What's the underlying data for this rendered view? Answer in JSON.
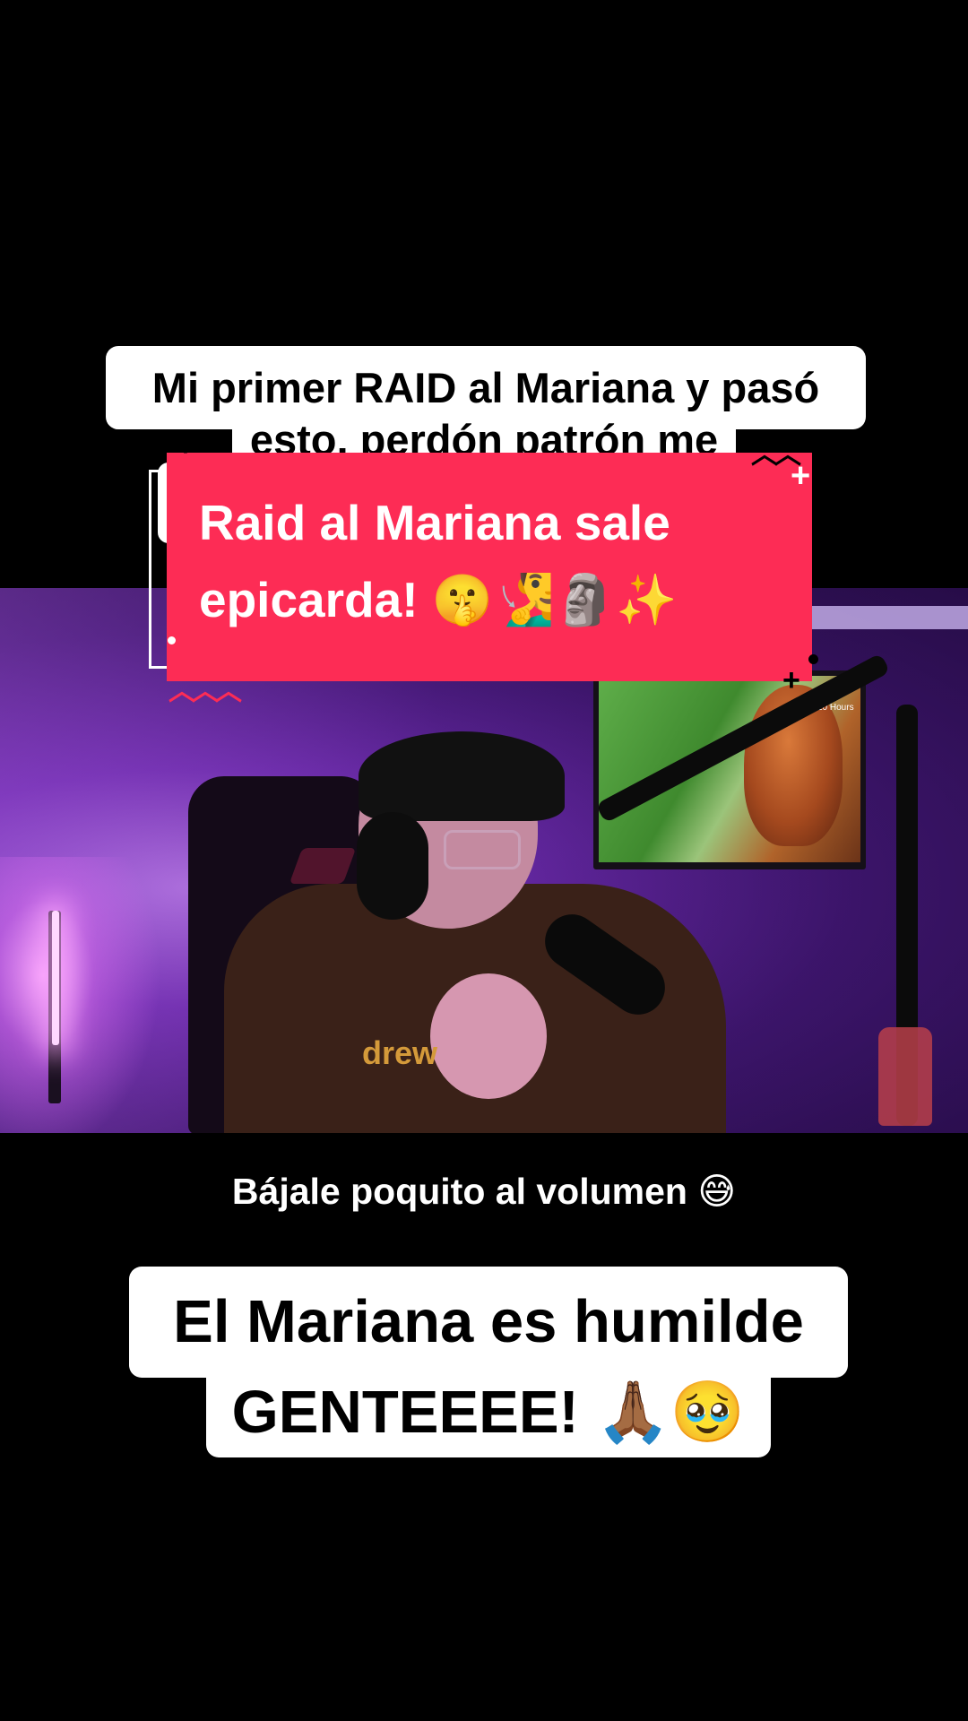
{
  "captions": {
    "top_line_1": "Mi primer RAID al Mariana y pasó",
    "top_line_2": "esto, perdón patrón me",
    "pink_line_1": "Raid al Mariana sale",
    "pink_line_2": "epicarda! 🤫🧏‍♂️🗿✨",
    "volume_note": "Bájale poquito al volumen 😅",
    "bottom_line_1": "El Mariana es humilde",
    "bottom_line_2": "GENTEEEE! 🙏🏾🥹"
  },
  "video": {
    "hoodie_text": "drew",
    "tv_logo": "10 Hours"
  },
  "colors": {
    "background": "#000000",
    "caption_box": "#ffffff",
    "accent_pink": "#fd2c55",
    "room_purple": "#6a2aa8"
  }
}
